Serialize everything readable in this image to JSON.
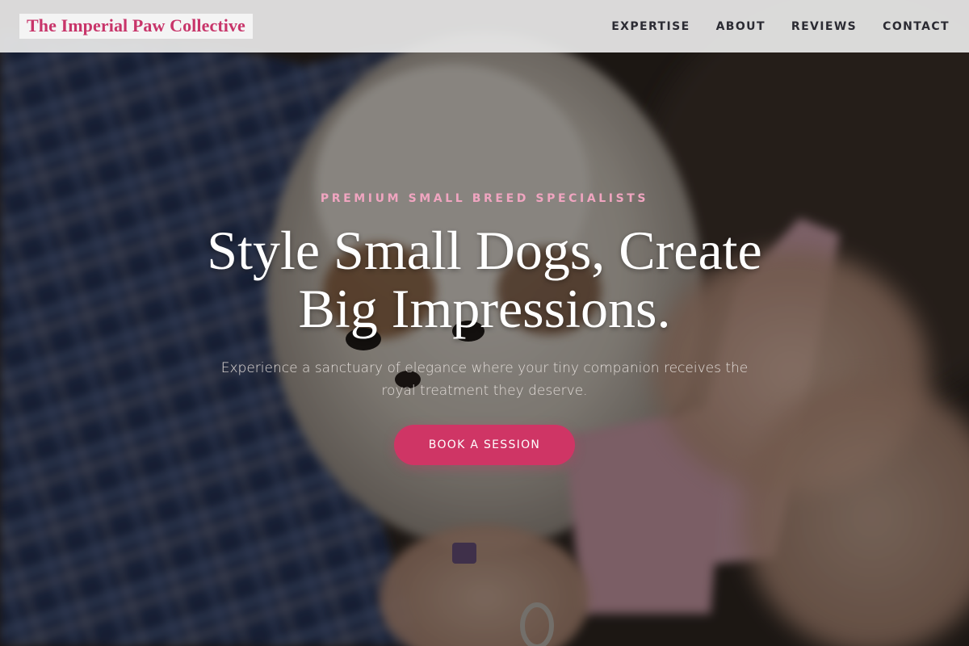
{
  "header": {
    "logo_text": "The Imperial Paw Collective",
    "nav": [
      {
        "label": "EXPERTISE"
      },
      {
        "label": "ABOUT"
      },
      {
        "label": "REVIEWS"
      },
      {
        "label": "CONTACT"
      }
    ]
  },
  "hero": {
    "eyebrow": "PREMIUM SMALL BREED SPECIALISTS",
    "headline_line1": "Style Small Dogs, Create",
    "headline_line2": "Big Impressions.",
    "subtext": "Experience a sanctuary of elegance where your tiny companion receives the royal treatment they deserve.",
    "cta_label": "BOOK A SESSION",
    "background_image": "groomer brushing a small fluffy dog wrapped in a plaid blanket"
  },
  "colors": {
    "brand_pink": "#cf3565",
    "eyebrow_pink": "#f0a5c0",
    "nav_text": "#2b2b33",
    "header_bg": "#e8e8e8"
  }
}
